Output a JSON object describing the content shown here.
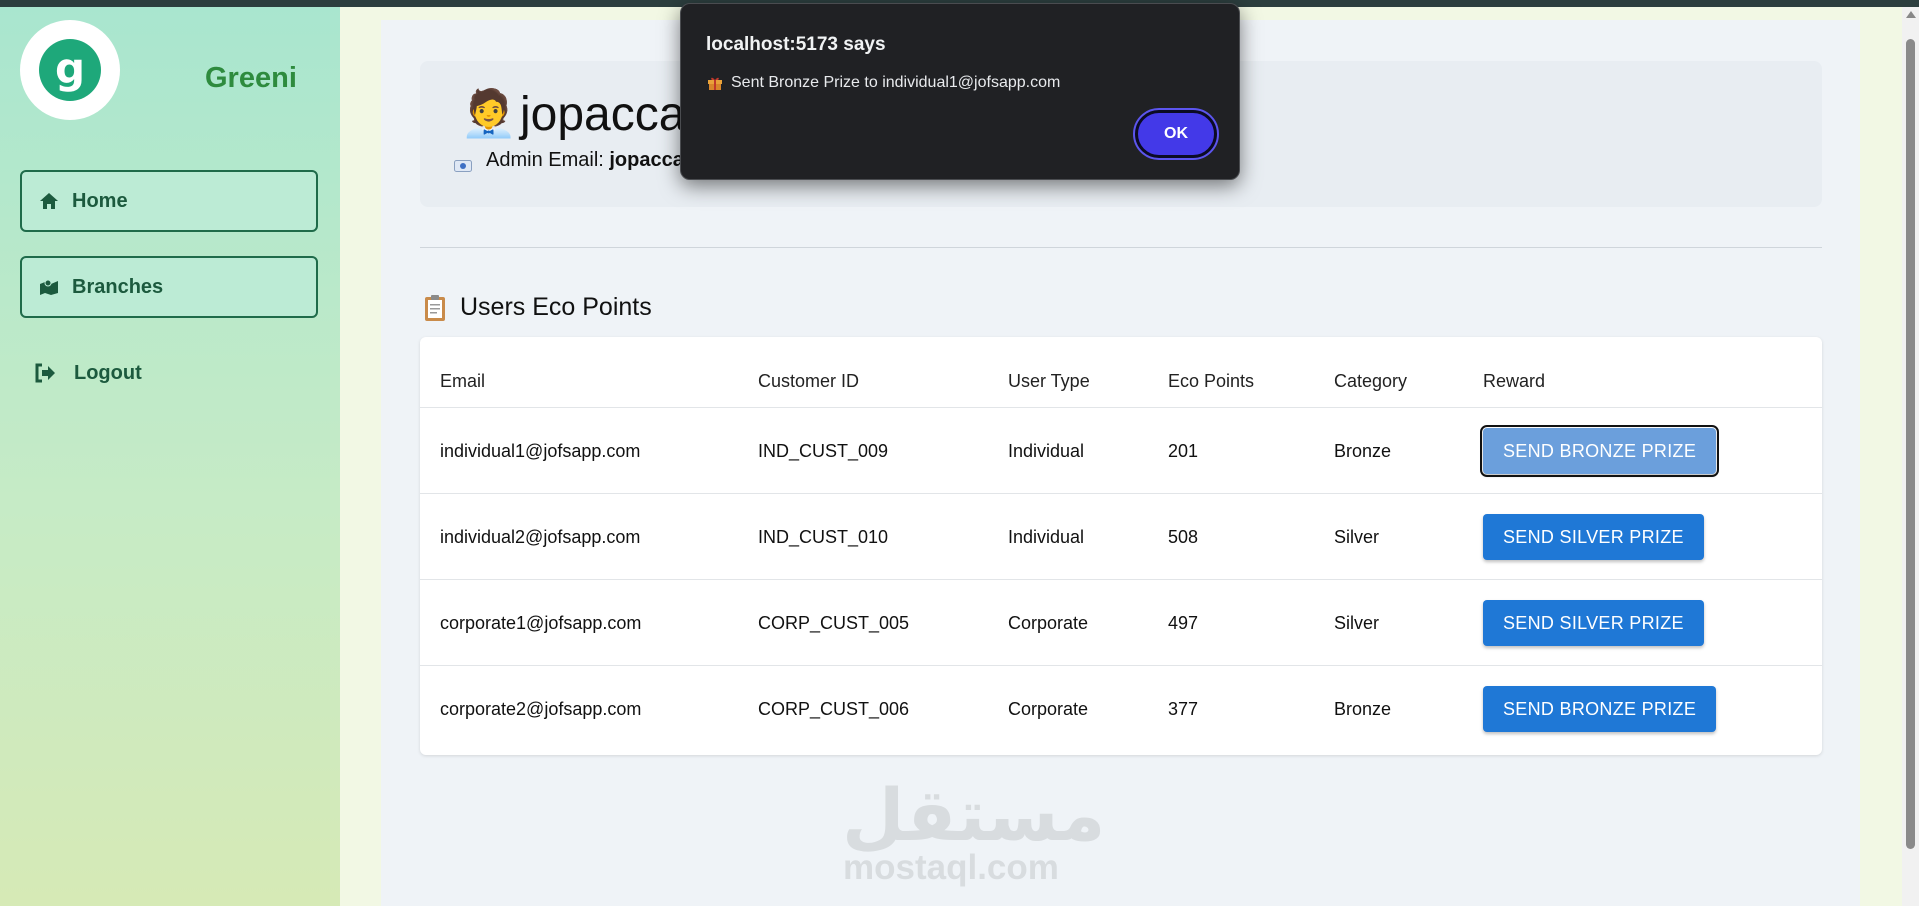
{
  "sidebar": {
    "brand": "Greeni",
    "logo_letter": "g",
    "items": [
      {
        "label": "Home",
        "icon": "home-icon"
      },
      {
        "label": "Branches",
        "icon": "map-icon"
      }
    ],
    "logout_label": "Logout"
  },
  "admin": {
    "emoji": "🧑‍💼",
    "name": "jopaccad",
    "email_label": "Admin Email:",
    "email_value": "jopacca"
  },
  "section": {
    "emoji": "📋",
    "title": "Users Eco Points"
  },
  "table": {
    "headers": [
      "Email",
      "Customer ID",
      "User Type",
      "Eco Points",
      "Category",
      "Reward"
    ],
    "rows": [
      {
        "email": "individual1@jofsapp.com",
        "customer_id": "IND_CUST_009",
        "user_type": "Individual",
        "eco_points": "201",
        "category": "Bronze",
        "reward": "SEND BRONZE PRIZE"
      },
      {
        "email": "individual2@jofsapp.com",
        "customer_id": "IND_CUST_010",
        "user_type": "Individual",
        "eco_points": "508",
        "category": "Silver",
        "reward": "SEND SILVER PRIZE"
      },
      {
        "email": "corporate1@jofsapp.com",
        "customer_id": "CORP_CUST_005",
        "user_type": "Corporate",
        "eco_points": "497",
        "category": "Silver",
        "reward": "SEND SILVER PRIZE"
      },
      {
        "email": "corporate2@jofsapp.com",
        "customer_id": "CORP_CUST_006",
        "user_type": "Corporate",
        "eco_points": "377",
        "category": "Bronze",
        "reward": "SEND BRONZE PRIZE"
      }
    ]
  },
  "dialog": {
    "title": "localhost:5173 says",
    "message": "Sent Bronze Prize to individual1@jofsapp.com",
    "ok_label": "OK"
  },
  "watermark": {
    "arabic": "مستقل",
    "latin": "mostaql.com"
  },
  "colors": {
    "primary_button": "#1f78d6",
    "brand_green": "#2e8b3e",
    "dialog_ok": "#4339e8"
  }
}
